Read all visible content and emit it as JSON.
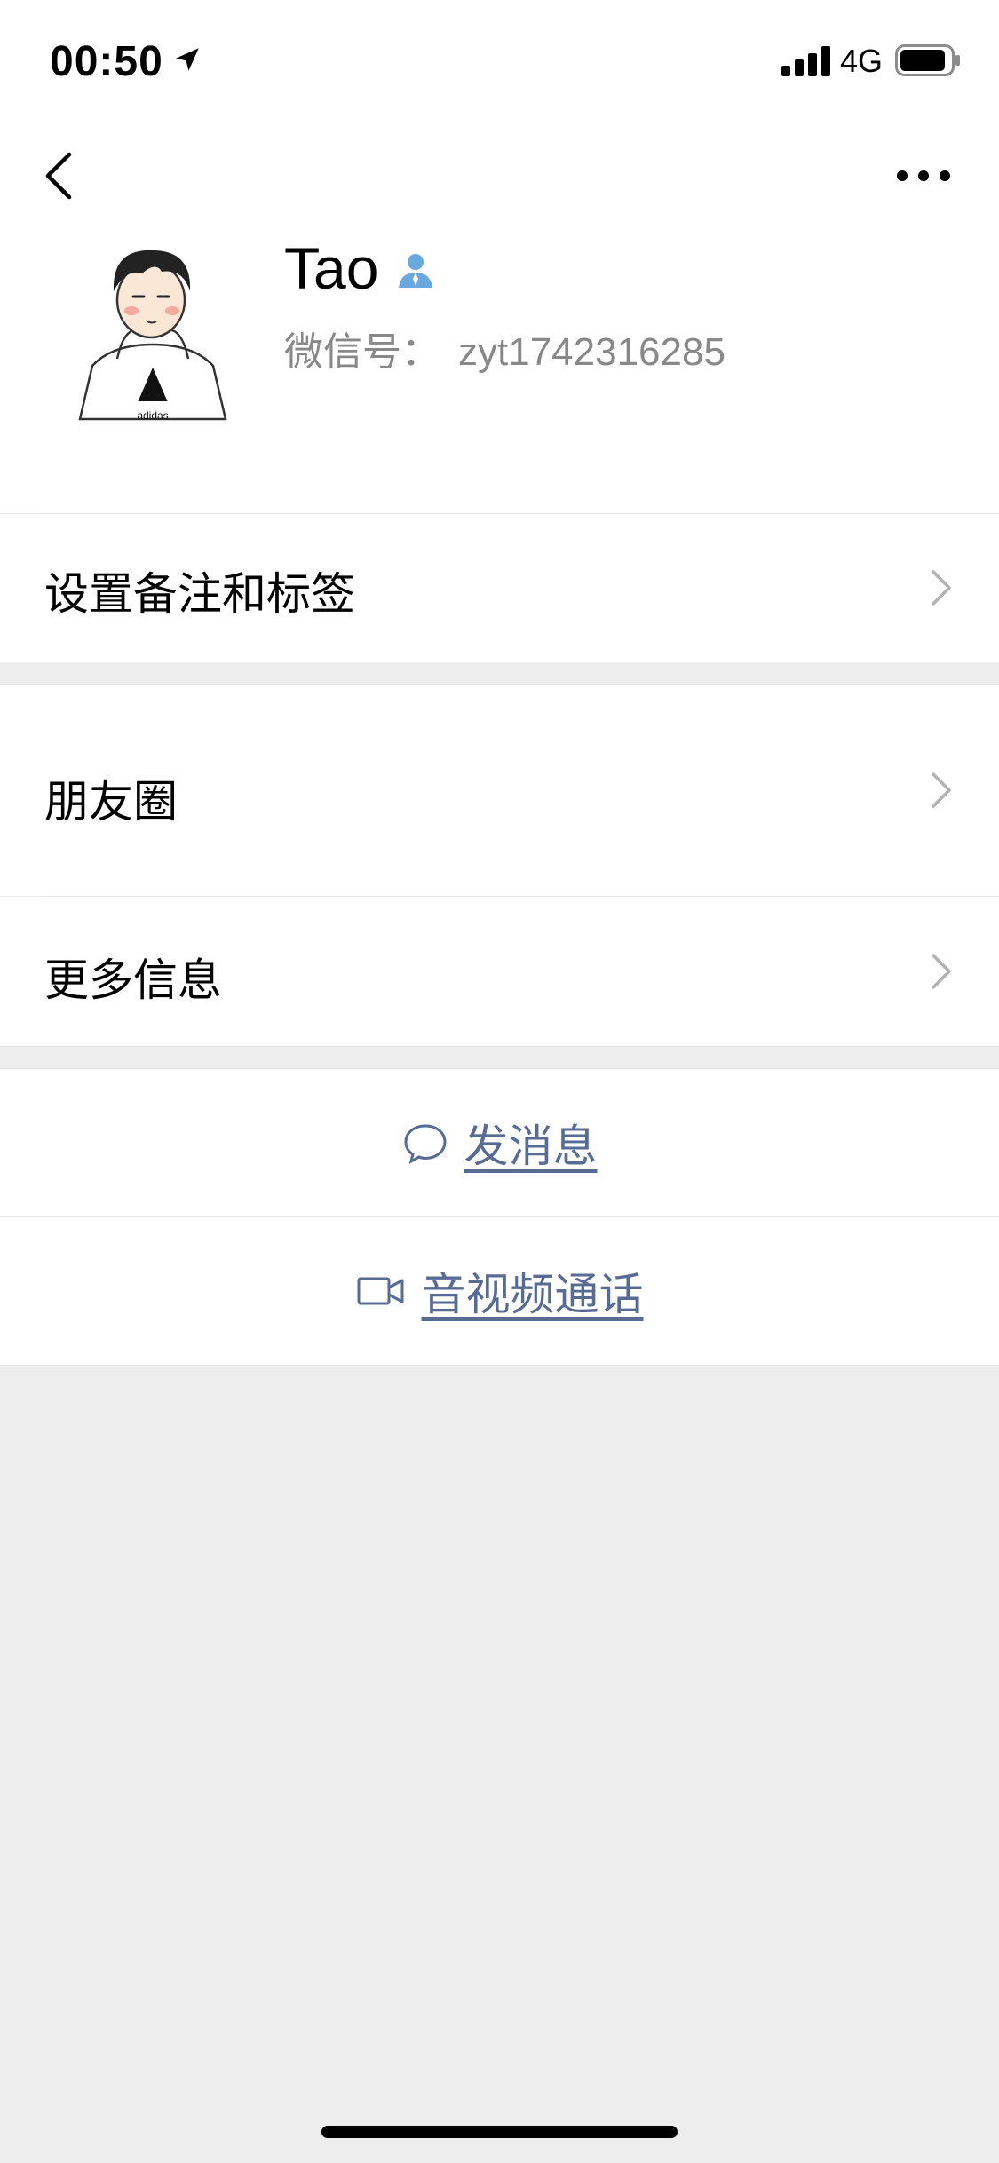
{
  "status_bar": {
    "time": "00:50",
    "network": "4G"
  },
  "profile": {
    "name": "Tao",
    "wxid_label": "微信号：",
    "wxid_value": "zyt1742316285"
  },
  "menu": {
    "remarks_tags": "设置备注和标签",
    "moments": "朋友圈",
    "more_info": "更多信息"
  },
  "actions": {
    "send_message": "发消息",
    "av_call": "音视频通话"
  },
  "colors": {
    "link": "#576b95",
    "background": "#ededed",
    "profile_icon": "#6aa9e0"
  },
  "icons": [
    "location-arrow-icon",
    "signal-icon",
    "battery-icon",
    "back-chevron-icon",
    "more-dots-icon",
    "contact-person-icon",
    "chevron-right-icon",
    "chat-bubble-icon",
    "video-camera-icon"
  ]
}
